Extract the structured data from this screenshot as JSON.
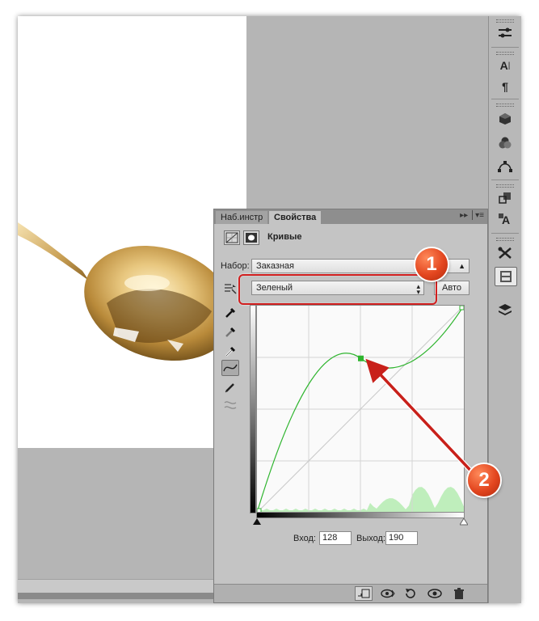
{
  "panel": {
    "tabs": [
      {
        "label": "Наб.инстр"
      },
      {
        "label": "Свойства"
      }
    ],
    "menu_glyph": "▸▸ │▾≡",
    "header": {
      "title": "Кривые"
    },
    "preset": {
      "label": "Набор:",
      "value": "Заказная"
    },
    "channel": {
      "value": "Зеленый"
    },
    "auto_button": "Авто",
    "input": {
      "label": "Вход:",
      "value": "128"
    },
    "output": {
      "label": "Выход:",
      "value": "190"
    }
  },
  "annotations": [
    {
      "label": "1"
    },
    {
      "label": "2"
    }
  ],
  "colors": {
    "curve": "#2fb52f",
    "histogram": "#bfeebc",
    "highlight": "#d11f1f",
    "badge": "#e3461f"
  },
  "curve_points": [
    {
      "input": 0,
      "output": 0
    },
    {
      "input": 128,
      "output": 190
    },
    {
      "input": 255,
      "output": 255
    }
  ],
  "icons": {
    "dock": [
      "adjustments-icon",
      "character-icon",
      "paragraph-icon",
      "3d-icon",
      "materials-icon",
      "paths-icon",
      "clone-source-icon",
      "styles-icon",
      "tools-preset-icon",
      "properties-icon",
      "layers-icon"
    ],
    "tools": [
      "on-image-adjust-icon",
      "black-point-eyedropper-icon",
      "gray-point-eyedropper-icon",
      "white-point-eyedropper-icon",
      "curve-points-icon",
      "pencil-icon",
      "smooth-icon"
    ],
    "footer": [
      "clip-to-layer-icon",
      "view-previous-icon",
      "reset-icon",
      "visibility-icon",
      "trash-icon"
    ]
  }
}
